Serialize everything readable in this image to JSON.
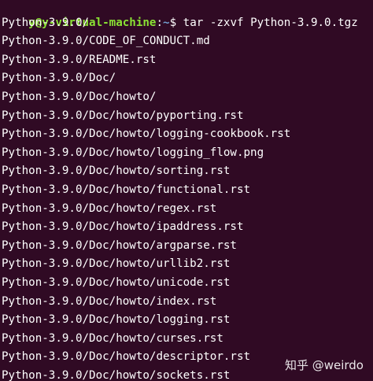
{
  "prompt": {
    "user_host": "y@y-virtual-machine",
    "separator": ":",
    "path": "~",
    "symbol": "$ ",
    "command": "tar -zxvf Python-3.9.0.tgz"
  },
  "output_lines": [
    "Python-3.9.0/",
    "Python-3.9.0/CODE_OF_CONDUCT.md",
    "Python-3.9.0/README.rst",
    "Python-3.9.0/Doc/",
    "Python-3.9.0/Doc/howto/",
    "Python-3.9.0/Doc/howto/pyporting.rst",
    "Python-3.9.0/Doc/howto/logging-cookbook.rst",
    "Python-3.9.0/Doc/howto/logging_flow.png",
    "Python-3.9.0/Doc/howto/sorting.rst",
    "Python-3.9.0/Doc/howto/functional.rst",
    "Python-3.9.0/Doc/howto/regex.rst",
    "Python-3.9.0/Doc/howto/ipaddress.rst",
    "Python-3.9.0/Doc/howto/argparse.rst",
    "Python-3.9.0/Doc/howto/urllib2.rst",
    "Python-3.9.0/Doc/howto/unicode.rst",
    "Python-3.9.0/Doc/howto/index.rst",
    "Python-3.9.0/Doc/howto/logging.rst",
    "Python-3.9.0/Doc/howto/curses.rst",
    "Python-3.9.0/Doc/howto/descriptor.rst",
    "Python-3.9.0/Doc/howto/sockets.rst"
  ],
  "watermark": "知乎 @weirdo",
  "colors": {
    "background": "#300a24",
    "text": "#ffffff",
    "user_host": "#8ae234",
    "path": "#729fcf"
  }
}
